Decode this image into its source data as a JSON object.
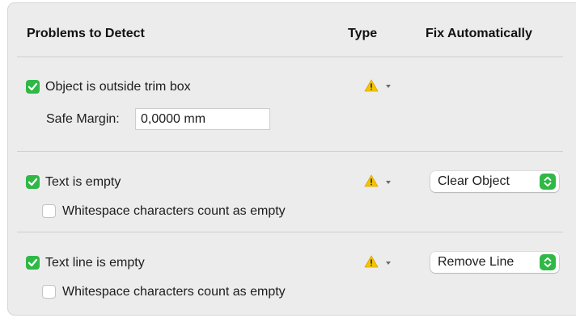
{
  "headers": {
    "problems": "Problems to Detect",
    "type": "Type",
    "fix": "Fix Automatically"
  },
  "rules": [
    {
      "label": "Object is outside trim box",
      "checked": true,
      "type_icon": "warning-icon",
      "margin_label": "Safe Margin:",
      "margin_value": "0,0000 mm"
    },
    {
      "label": "Text is empty",
      "checked": true,
      "type_icon": "warning-icon",
      "fix_value": "Clear Object",
      "option_label": "Whitespace characters count as empty",
      "option_checked": false
    },
    {
      "label": "Text line is empty",
      "checked": true,
      "type_icon": "warning-icon",
      "fix_value": "Remove Line",
      "option_label": "Whitespace characters count as empty",
      "option_checked": false
    }
  ],
  "colors": {
    "accent": "#2fb846",
    "warning": "#f5c400"
  }
}
